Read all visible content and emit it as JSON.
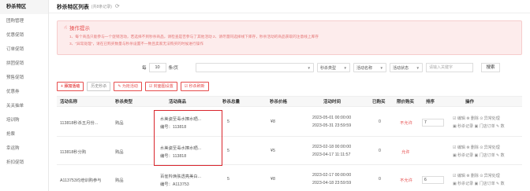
{
  "sidebar": {
    "items": [
      {
        "label": "秒杀特区",
        "active": true
      },
      {
        "label": "团购管理"
      },
      {
        "label": "优惠促销"
      },
      {
        "label": "订单促销"
      },
      {
        "label": "拼团促销"
      },
      {
        "label": "预售促销"
      },
      {
        "label": "优惠券"
      },
      {
        "label": "关关抽单"
      },
      {
        "label": "培训购"
      },
      {
        "label": "抢票"
      },
      {
        "label": "幸运购"
      },
      {
        "label": "折扣促销"
      }
    ]
  },
  "header": {
    "title": "秒杀特区列表",
    "count": "(共8条记录)"
  },
  "tips": {
    "title": "操作提示",
    "lines": [
      "1、每个商品只能参与一个促销活动，若选择不到秒杀商品，请检查是否参与了其他活动  2、请尽量同选择线下库存，秒杀活动的商品获取的注意线上库存",
      "3、\"异常处理\"，请在已购买数量与秒杀设置不一致且卖家无法购买的时候进行操作"
    ]
  },
  "pager": {
    "prefix": "每",
    "value": "10",
    "suffix": "条/页"
  },
  "filters": {
    "type_select": "秒杀类型",
    "name_select": "活动名称",
    "status_select": "活动状态",
    "search_placeholder": "请输入关键字",
    "search_button": "搜索"
  },
  "actions": {
    "add": "+ 添加活动",
    "history": "历史秒杀",
    "batch": "✎ 为抢活动",
    "cover": "☑ 封面图设置",
    "refresh": "☑ 秒杀刷新"
  },
  "table": {
    "headers": [
      "活动名称",
      "秒杀类型",
      "活动商品",
      "秒杀总量",
      "秒杀价格",
      "活动时间",
      "已购买",
      "限价购买",
      "排序",
      "操作"
    ],
    "rows": [
      {
        "name": "113818秒杀五月份...",
        "type": "购品",
        "product": "水美姿至毒水擦水晒...",
        "code": "编号：113818",
        "total": "5",
        "price": "¥8",
        "start": "2023-05-01 00:00:00",
        "end": "2023-05-31 23:59:59",
        "bought": "0",
        "limit": "不允许",
        "sort": "7",
        "op1": "☑ 编辑  ⊗ 删除  ⊙ 异常处理",
        "op2": "▣ 秒杀记录  ▣ 门店订单  ✎ 数"
      },
      {
        "name": "113818秒分购",
        "type": "购品",
        "product": "水美姿至毒水擦水晒...",
        "code": "编号：113818",
        "total": "5",
        "price": "¥5",
        "start": "2023-02-18 00:00:00",
        "end": "2023-04-17 11:11:57",
        "bought": "0",
        "limit": "允许",
        "sort": "",
        "op1": "☑ 编辑  ⊗ 删除  ⊙ 异常处理",
        "op2": "▣ 秒杀记录  ▣ 门店订单  ✎ 数"
      },
      {
        "name": "A113753均培训购参与",
        "type": "购品",
        "product": "百雀羚焕肤透亮美白...",
        "code": "编号：A113753",
        "total": "5",
        "price": "¥8",
        "start": "2023-02-17 00:00:00",
        "end": "2023-04-18 23:59:59",
        "bought": "0",
        "limit": "不允许",
        "sort": "6",
        "op1": "☑ 编辑  ⊗ 删除  ⊙ 异常处理",
        "op2": "▣ 秒杀记录  ▣ 门店订单  ✎ 数"
      }
    ]
  }
}
